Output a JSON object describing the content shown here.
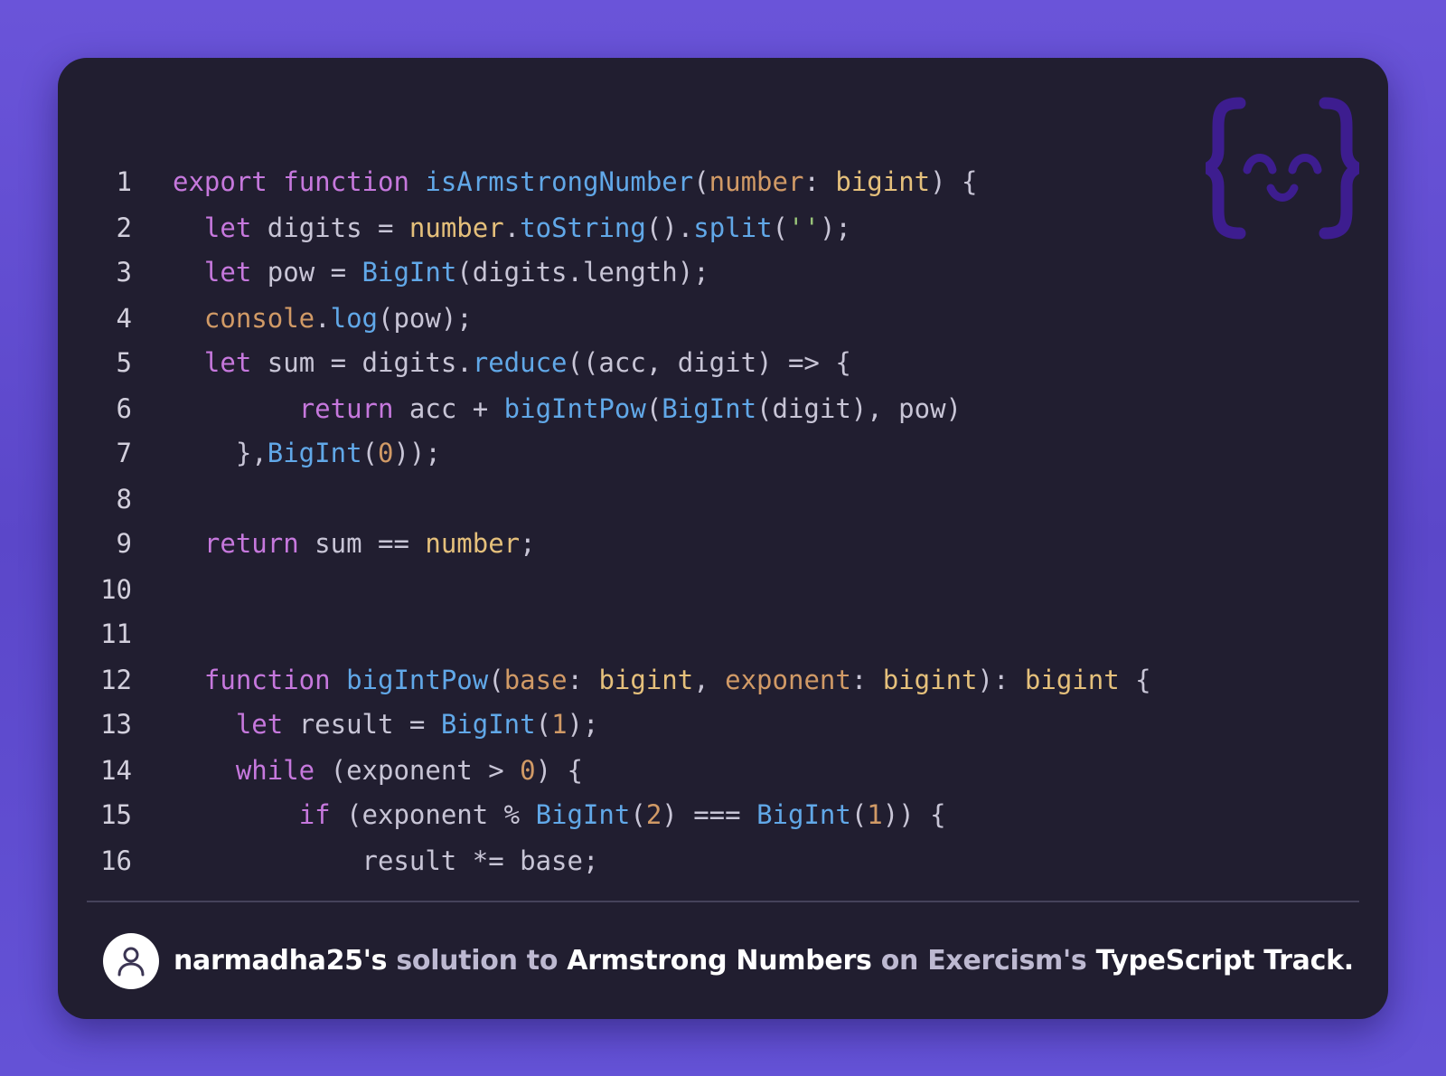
{
  "code": {
    "lines": [
      {
        "n": "1",
        "tokens": [
          [
            "kw",
            "export"
          ],
          [
            "pl",
            " "
          ],
          [
            "kw",
            "function"
          ],
          [
            "pl",
            " "
          ],
          [
            "fn",
            "isArmstrongNumber"
          ],
          [
            "pl",
            "("
          ],
          [
            "num",
            "number"
          ],
          [
            "pl",
            ": "
          ],
          [
            "ty",
            "bigint"
          ],
          [
            "pl",
            ") {"
          ]
        ]
      },
      {
        "n": "2",
        "tokens": [
          [
            "pl",
            "  "
          ],
          [
            "kw",
            "let"
          ],
          [
            "pl",
            " digits = "
          ],
          [
            "ty",
            "number"
          ],
          [
            "pl",
            "."
          ],
          [
            "fn",
            "toString"
          ],
          [
            "pl",
            "()."
          ],
          [
            "fn",
            "split"
          ],
          [
            "pl",
            "("
          ],
          [
            "str",
            "''"
          ],
          [
            "pl",
            ");"
          ]
        ]
      },
      {
        "n": "3",
        "tokens": [
          [
            "pl",
            "  "
          ],
          [
            "kw",
            "let"
          ],
          [
            "pl",
            " pow = "
          ],
          [
            "fn",
            "BigInt"
          ],
          [
            "pl",
            "(digits.length);"
          ]
        ]
      },
      {
        "n": "4",
        "tokens": [
          [
            "pl",
            "  "
          ],
          [
            "num",
            "console"
          ],
          [
            "pl",
            "."
          ],
          [
            "fn",
            "log"
          ],
          [
            "pl",
            "(pow);"
          ]
        ]
      },
      {
        "n": "5",
        "tokens": [
          [
            "pl",
            "  "
          ],
          [
            "kw",
            "let"
          ],
          [
            "pl",
            " sum = digits."
          ],
          [
            "fn",
            "reduce"
          ],
          [
            "pl",
            "((acc, digit) => {"
          ]
        ]
      },
      {
        "n": "6",
        "tokens": [
          [
            "pl",
            "        "
          ],
          [
            "kw",
            "return"
          ],
          [
            "pl",
            " acc + "
          ],
          [
            "fn",
            "bigIntPow"
          ],
          [
            "pl",
            "("
          ],
          [
            "fn",
            "BigInt"
          ],
          [
            "pl",
            "(digit), pow)"
          ]
        ]
      },
      {
        "n": "7",
        "tokens": [
          [
            "pl",
            "    },"
          ],
          [
            "fn",
            "BigInt"
          ],
          [
            "pl",
            "("
          ],
          [
            "num",
            "0"
          ],
          [
            "pl",
            "));"
          ]
        ]
      },
      {
        "n": "8",
        "tokens": []
      },
      {
        "n": "9",
        "tokens": [
          [
            "pl",
            "  "
          ],
          [
            "kw",
            "return"
          ],
          [
            "pl",
            " sum == "
          ],
          [
            "ty",
            "number"
          ],
          [
            "pl",
            ";"
          ]
        ]
      },
      {
        "n": "10",
        "tokens": []
      },
      {
        "n": "11",
        "tokens": []
      },
      {
        "n": "12",
        "tokens": [
          [
            "pl",
            "  "
          ],
          [
            "kw",
            "function"
          ],
          [
            "pl",
            " "
          ],
          [
            "fn",
            "bigIntPow"
          ],
          [
            "pl",
            "("
          ],
          [
            "num",
            "base"
          ],
          [
            "pl",
            ": "
          ],
          [
            "ty",
            "bigint"
          ],
          [
            "pl",
            ", "
          ],
          [
            "num",
            "exponent"
          ],
          [
            "pl",
            ": "
          ],
          [
            "ty",
            "bigint"
          ],
          [
            "pl",
            "): "
          ],
          [
            "ty",
            "bigint"
          ],
          [
            "pl",
            " {"
          ]
        ]
      },
      {
        "n": "13",
        "tokens": [
          [
            "pl",
            "    "
          ],
          [
            "kw",
            "let"
          ],
          [
            "pl",
            " result = "
          ],
          [
            "fn",
            "BigInt"
          ],
          [
            "pl",
            "("
          ],
          [
            "num",
            "1"
          ],
          [
            "pl",
            ");"
          ]
        ]
      },
      {
        "n": "14",
        "tokens": [
          [
            "pl",
            "    "
          ],
          [
            "kw",
            "while"
          ],
          [
            "pl",
            " (exponent > "
          ],
          [
            "num",
            "0"
          ],
          [
            "pl",
            ") {"
          ]
        ]
      },
      {
        "n": "15",
        "tokens": [
          [
            "pl",
            "        "
          ],
          [
            "kw",
            "if"
          ],
          [
            "pl",
            " (exponent % "
          ],
          [
            "fn",
            "BigInt"
          ],
          [
            "pl",
            "("
          ],
          [
            "num",
            "2"
          ],
          [
            "pl",
            ") === "
          ],
          [
            "fn",
            "BigInt"
          ],
          [
            "pl",
            "("
          ],
          [
            "num",
            "1"
          ],
          [
            "pl",
            ")) {"
          ]
        ]
      },
      {
        "n": "16",
        "tokens": [
          [
            "pl",
            "            result *= base;"
          ]
        ]
      }
    ]
  },
  "logo": {
    "icon": "exercism-logo-icon",
    "color": "#3d1d8f"
  },
  "footer": {
    "avatar_icon": "user-icon",
    "user": "narmadha25's",
    "text1": "solution to",
    "exercise": "Armstrong Numbers",
    "text2": "on",
    "site": "Exercism's",
    "track": "TypeScript Track."
  },
  "colors": {
    "background": "#5f4bd0",
    "card": "#211e30",
    "keyword": "#c678dd",
    "function": "#61a8e8",
    "type": "#e5c07b",
    "number": "#d19a66",
    "string": "#98c379",
    "plain": "#c8c5d6"
  }
}
